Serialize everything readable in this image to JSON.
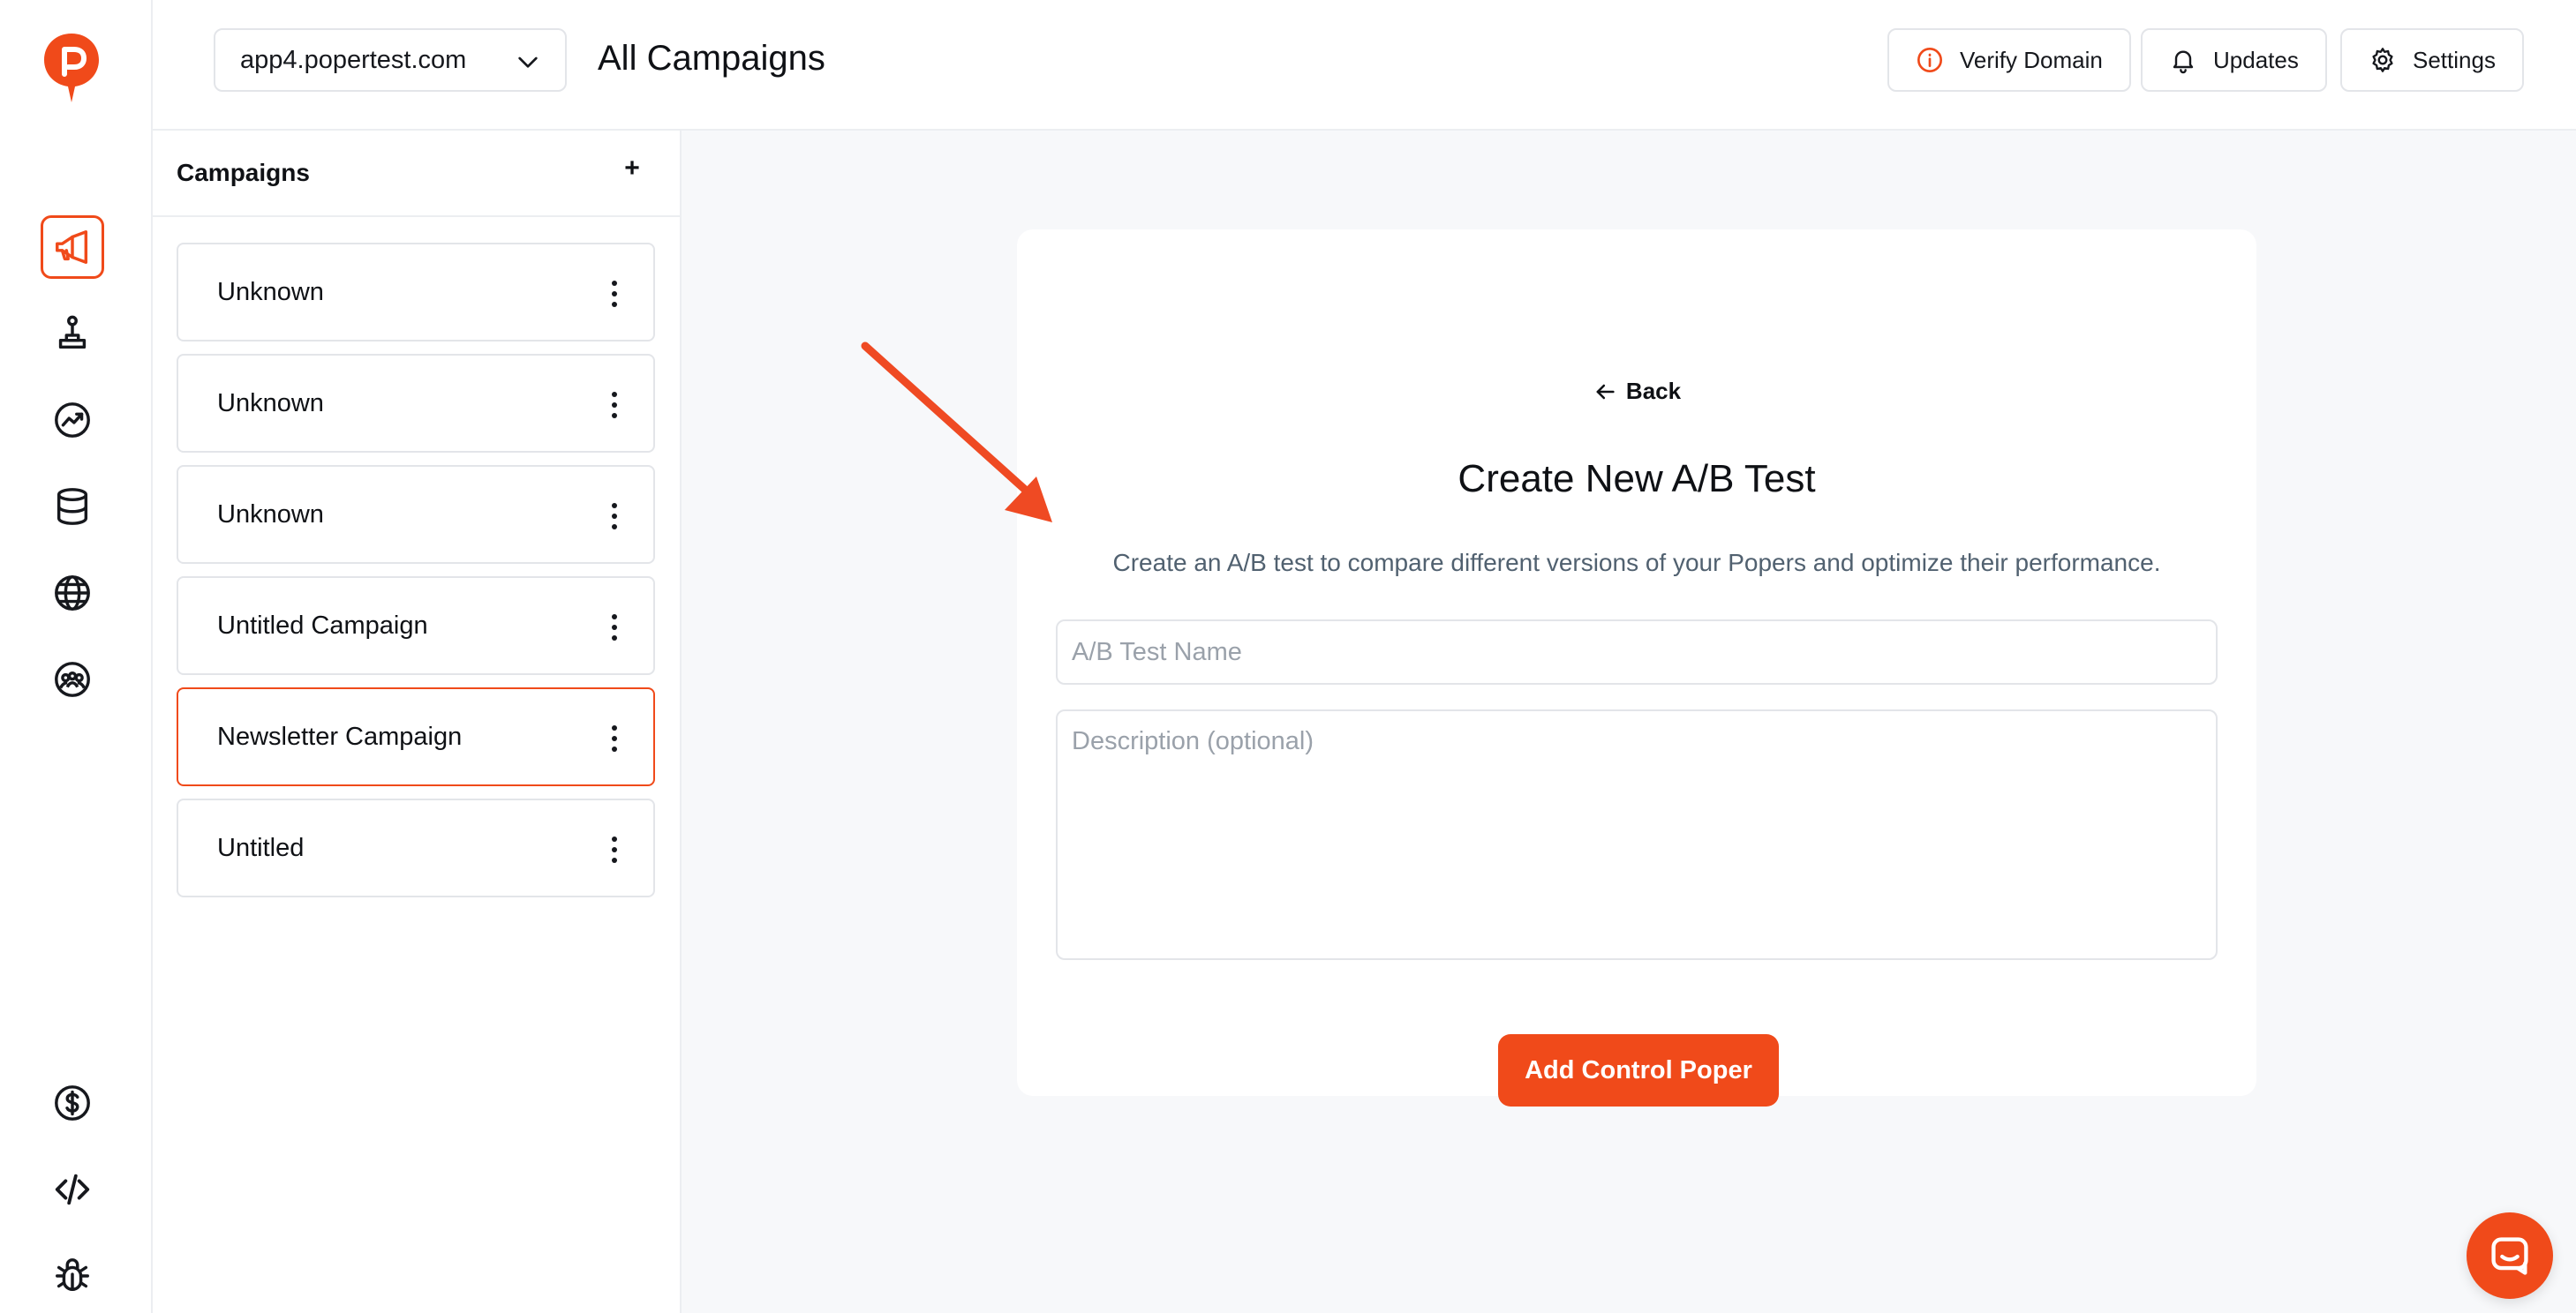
{
  "header": {
    "domain_select": "app4.popertest.com",
    "page_title": "All Campaigns",
    "verify_label": "Verify Domain",
    "updates_label": "Updates",
    "settings_label": "Settings"
  },
  "campaigns": {
    "title": "Campaigns",
    "add_label": "+",
    "items": [
      {
        "label": "Unknown"
      },
      {
        "label": "Unknown"
      },
      {
        "label": "Unknown"
      },
      {
        "label": "Untitled Campaign"
      },
      {
        "label": "Newsletter Campaign",
        "selected": true
      },
      {
        "label": "Untitled"
      }
    ]
  },
  "form": {
    "back_label": "Back",
    "title": "Create New A/B Test",
    "subtitle": "Create an A/B test to compare different versions of your Popers and optimize their performance.",
    "name_placeholder": "A/B Test Name",
    "name_value": "",
    "description_placeholder": "Description (optional)",
    "description_value": "",
    "submit_label": "Add Control Poper"
  },
  "rail": {
    "top_icons": [
      "megaphone-icon",
      "joystick-icon",
      "trend-chart-icon",
      "database-icon",
      "globe-icon",
      "group-icon"
    ],
    "active_icon": "megaphone-icon",
    "bottom_icons": [
      "dollar-icon",
      "code-icon",
      "bug-icon"
    ]
  },
  "colors": {
    "accent": "#f04a1a",
    "border": "#e3e5e9",
    "muted_text": "#516170",
    "placeholder": "#9aa1aa",
    "main_bg": "#f7f8fa"
  }
}
